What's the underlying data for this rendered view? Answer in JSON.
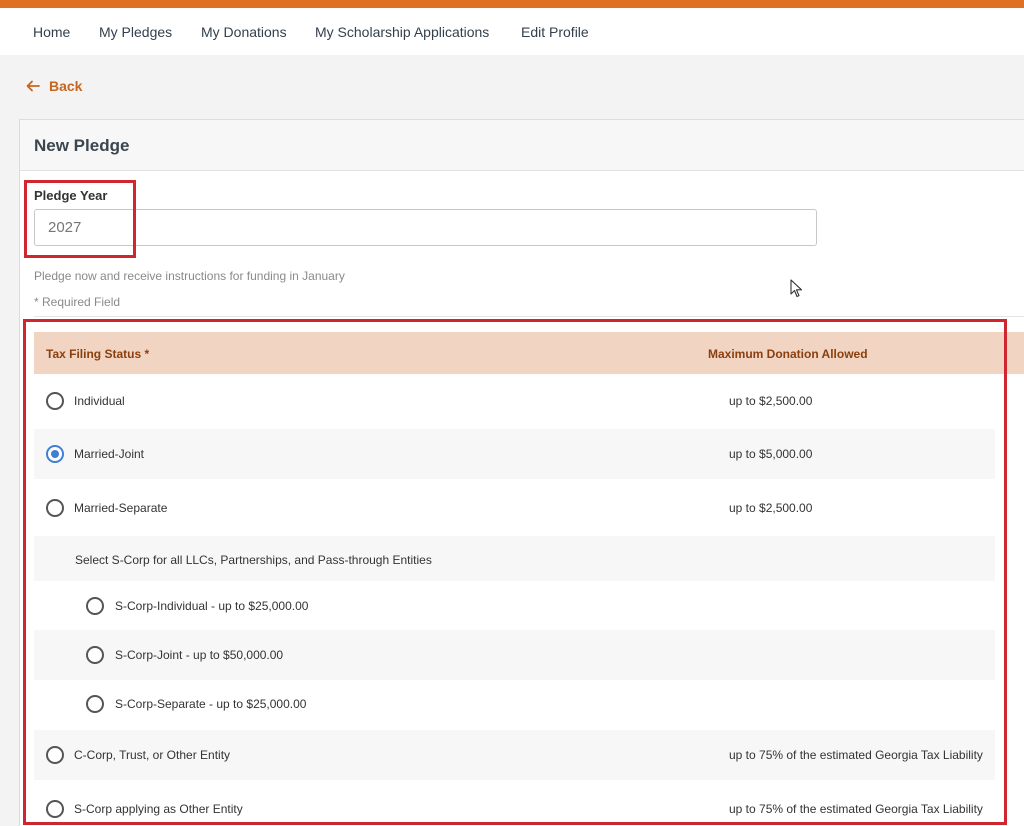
{
  "nav": {
    "items": [
      "Home",
      "My Pledges",
      "My Donations",
      "My Scholarship Applications",
      "Edit Profile"
    ]
  },
  "back": {
    "label": "Back"
  },
  "card": {
    "title": "New Pledge",
    "year_label": "Pledge Year",
    "year_value": "2027",
    "hint": "Pledge now and receive instructions for funding in January",
    "required_note": "* Required Field"
  },
  "table": {
    "col_status": "Tax Filing Status *",
    "col_max": "Maximum Donation Allowed",
    "options": [
      {
        "label": "Individual",
        "amount": "up to $2,500.00",
        "checked": false
      },
      {
        "label": "Married-Joint",
        "amount": "up to $5,000.00",
        "checked": true
      },
      {
        "label": "Married-Separate",
        "amount": "up to $2,500.00",
        "checked": false
      }
    ],
    "scorp_note": "Select S-Corp for all LLCs, Partnerships, and Pass-through Entities",
    "scorp_options": [
      {
        "label": "S-Corp-Individual - up to $25,000.00",
        "checked": false
      },
      {
        "label": "S-Corp-Joint - up to $50,000.00",
        "checked": false
      },
      {
        "label": "S-Corp-Separate - up to $25,000.00",
        "checked": false
      }
    ],
    "other_options": [
      {
        "label": "C-Corp, Trust, or Other Entity",
        "amount": "up to 75% of the estimated Georgia Tax Liability",
        "checked": false
      },
      {
        "label": "S-Corp applying as Other Entity",
        "amount": "up to 75% of the estimated Georgia Tax Liability",
        "checked": false
      }
    ]
  },
  "colors": {
    "accent_orange": "#e07024",
    "header_band": "#f1d4c2",
    "header_text": "#8a3f0f",
    "radio_checked": "#3f7fd6",
    "highlight_red": "#d0262f"
  }
}
